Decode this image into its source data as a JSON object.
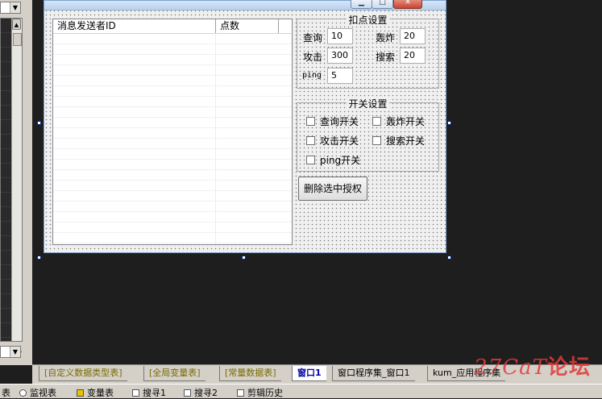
{
  "window": {
    "minimize_glyph": "▁",
    "maximize_glyph": "□",
    "close_glyph": "✕"
  },
  "listview": {
    "columns": [
      "消息发送者ID",
      "点数"
    ]
  },
  "deduct_group": {
    "title": "扣点设置",
    "query_label": "查询",
    "query_value": "10",
    "bomb_label": "轰炸",
    "bomb_value": "20",
    "attack_label": "攻击",
    "attack_value": "300",
    "search_label": "搜索",
    "search_value": "20",
    "ping_label": "ping",
    "ping_value": "5"
  },
  "switch_group": {
    "title": "开关设置",
    "query_switch": "查询开关",
    "bomb_switch": "轰炸开关",
    "attack_switch": "攻击开关",
    "search_switch": "搜索开关",
    "ping_switch": "ping开关"
  },
  "delete_button": "删除选中授权",
  "tabs": [
    "[自定义数据类型表]",
    "[全局变量表]",
    "[常量数据表]",
    "窗口1",
    "窗口程序集_窗口1",
    "kum_应用程序集"
  ],
  "statusbar": {
    "item1": "表",
    "item2": "监视表",
    "item3": "变量表",
    "item4": "搜寻1",
    "item5": "搜寻2",
    "item6": "剪辑历史"
  },
  "watermark": {
    "main": "27CaT",
    "sub": "论坛"
  }
}
